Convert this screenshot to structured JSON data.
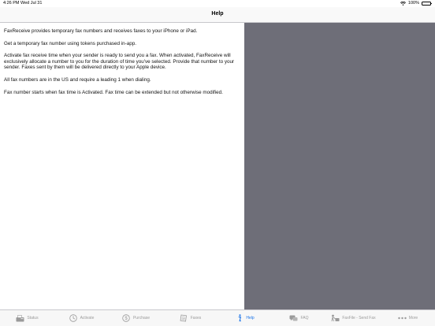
{
  "status_bar": {
    "time": "4:26 PM",
    "date": "Wed Jul 31",
    "battery": "100%"
  },
  "nav": {
    "title": "Help"
  },
  "help": {
    "paragraphs": [
      "FaxReceive provides temporary fax numbers and receives faxes to your iPhone or iPad.",
      "Get a temporary fax number using tokens purchased in-app.",
      "Activate fax receive time when your sender is ready to send you a fax.  When activated, FaxReceive will exclusively allocate a number to you for the duration of time you've selected.  Provide that number to your sender.  Faxes sent by them will be delivered directly to your Apple device.",
      "All fax numbers are in the US and require a leading 1 when dialing.",
      "Fax number starts when fax time is Activated. Fax time can be extended but not otherwise modified."
    ]
  },
  "tabs": [
    {
      "label": "Status",
      "icon": "fax-machine-icon",
      "active": false
    },
    {
      "label": "Activate",
      "icon": "clock-icon",
      "active": false
    },
    {
      "label": "Purchase",
      "icon": "dollar-coin-icon",
      "active": false
    },
    {
      "label": "Faxes",
      "icon": "document-icon",
      "active": false
    },
    {
      "label": "Help",
      "icon": "info-icon",
      "active": true
    },
    {
      "label": "FAQ",
      "icon": "chat-bubbles-icon",
      "active": false
    },
    {
      "label": "FaxFile - Send Fax",
      "icon": "person-fax-icon",
      "active": false
    },
    {
      "label": "More",
      "icon": "ellipsis-icon",
      "active": false
    }
  ],
  "colors": {
    "accent": "#1a73e8",
    "inactive_tab": "#9a9a9a",
    "side_pane": "#6e6e78"
  }
}
